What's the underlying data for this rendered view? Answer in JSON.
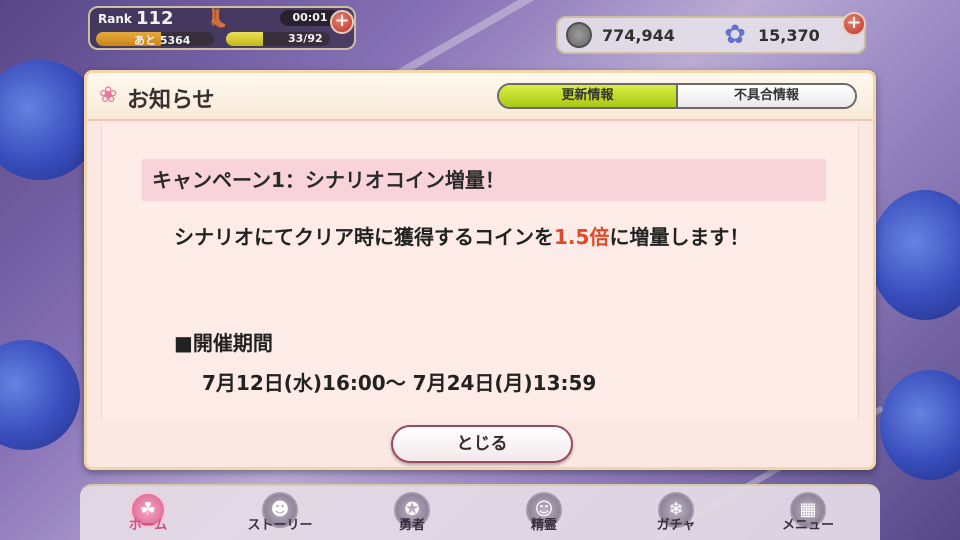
{
  "hud": {
    "rank_label": "Rank",
    "rank_value": "112",
    "exp_remaining": "あと 5364",
    "exp_progress": 0.55,
    "stamina_timer": "00:01",
    "stamina_value": "33/92",
    "stamina_progress": 0.36,
    "coins": "774,944",
    "crystals": "15,370",
    "add_label": "+"
  },
  "dialog": {
    "title": "お知らせ",
    "tabs": [
      {
        "label": "更新情報",
        "active": true
      },
      {
        "label": "不具合情報",
        "active": false
      }
    ],
    "heading": "キャンペーン1：シナリオコイン増量！",
    "desc_part1": "シナリオにてクリア時に獲得するコインを",
    "desc_highlight": "1.5倍",
    "desc_part2": "に増量します！",
    "period_label": "■開催期間",
    "period_value": "7月12日(水)16:00～ 7月24日(月)13:59",
    "close_label": "とじる"
  },
  "nav": {
    "items": [
      {
        "label": "ホーム",
        "active": true
      },
      {
        "label": "ストーリー",
        "active": false
      },
      {
        "label": "勇者",
        "active": false
      },
      {
        "label": "精霊",
        "active": false
      },
      {
        "label": "ガチャ",
        "active": false
      },
      {
        "label": "メニュー",
        "active": false
      }
    ]
  },
  "colors": {
    "accent_pink": "#d84a82",
    "highlight_red": "#e04a2a",
    "tab_active_green": "#c8de30"
  }
}
